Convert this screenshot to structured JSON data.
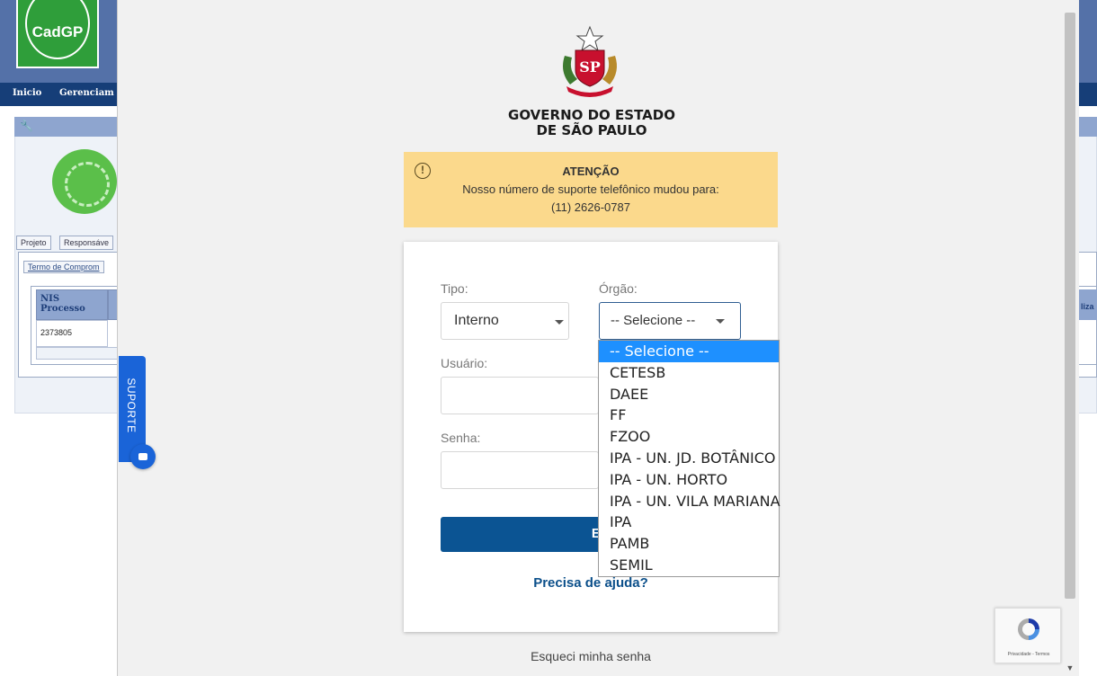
{
  "background": {
    "logo_text": "CadGP",
    "nav": [
      "Inicio",
      "Gerenciam"
    ],
    "tabs": [
      "Projeto",
      "Responsáve"
    ],
    "subtab": "Termo de Comprom",
    "table": {
      "header": "NIS Processo",
      "row_value": "2373805",
      "partial_header": "liza"
    }
  },
  "brand": {
    "line1": "GOVERNO DO ESTADO",
    "line2": "DE SÃO PAULO",
    "seal_text": "SP"
  },
  "alert": {
    "icon": "exclamation-circle-icon",
    "title": "ATENÇÃO",
    "message": "Nosso número de suporte telefônico mudou para:",
    "phone": "(11) 2626-0787",
    "color": "#fbd98c"
  },
  "login": {
    "tipo_label": "Tipo:",
    "tipo_value": "Interno",
    "orgao_label": "Órgão:",
    "orgao_value": "-- Selecione --",
    "usuario_label": "Usuário:",
    "senha_label": "Senha:",
    "enter_label": "Entrar",
    "help_link": "Precisa de ajuda?",
    "forgot_password": "Esqueci minha senha",
    "button_color": "#0b5493"
  },
  "dropdown": {
    "options": [
      "-- Selecione --",
      "CETESB",
      "DAEE",
      "FF",
      "FZOO",
      "IPA - UN. JD. BOTÂNICO",
      "IPA - UN. HORTO",
      "IPA - UN. VILA MARIANA",
      "IPA",
      "PAMB",
      "SEMIL"
    ],
    "selected_index": 0,
    "highlight_color": "#1e90ff"
  },
  "support": {
    "label": "SUPORTE",
    "color": "#1a64d8"
  },
  "recaptcha": {
    "text": "Privacidade - Termos"
  }
}
